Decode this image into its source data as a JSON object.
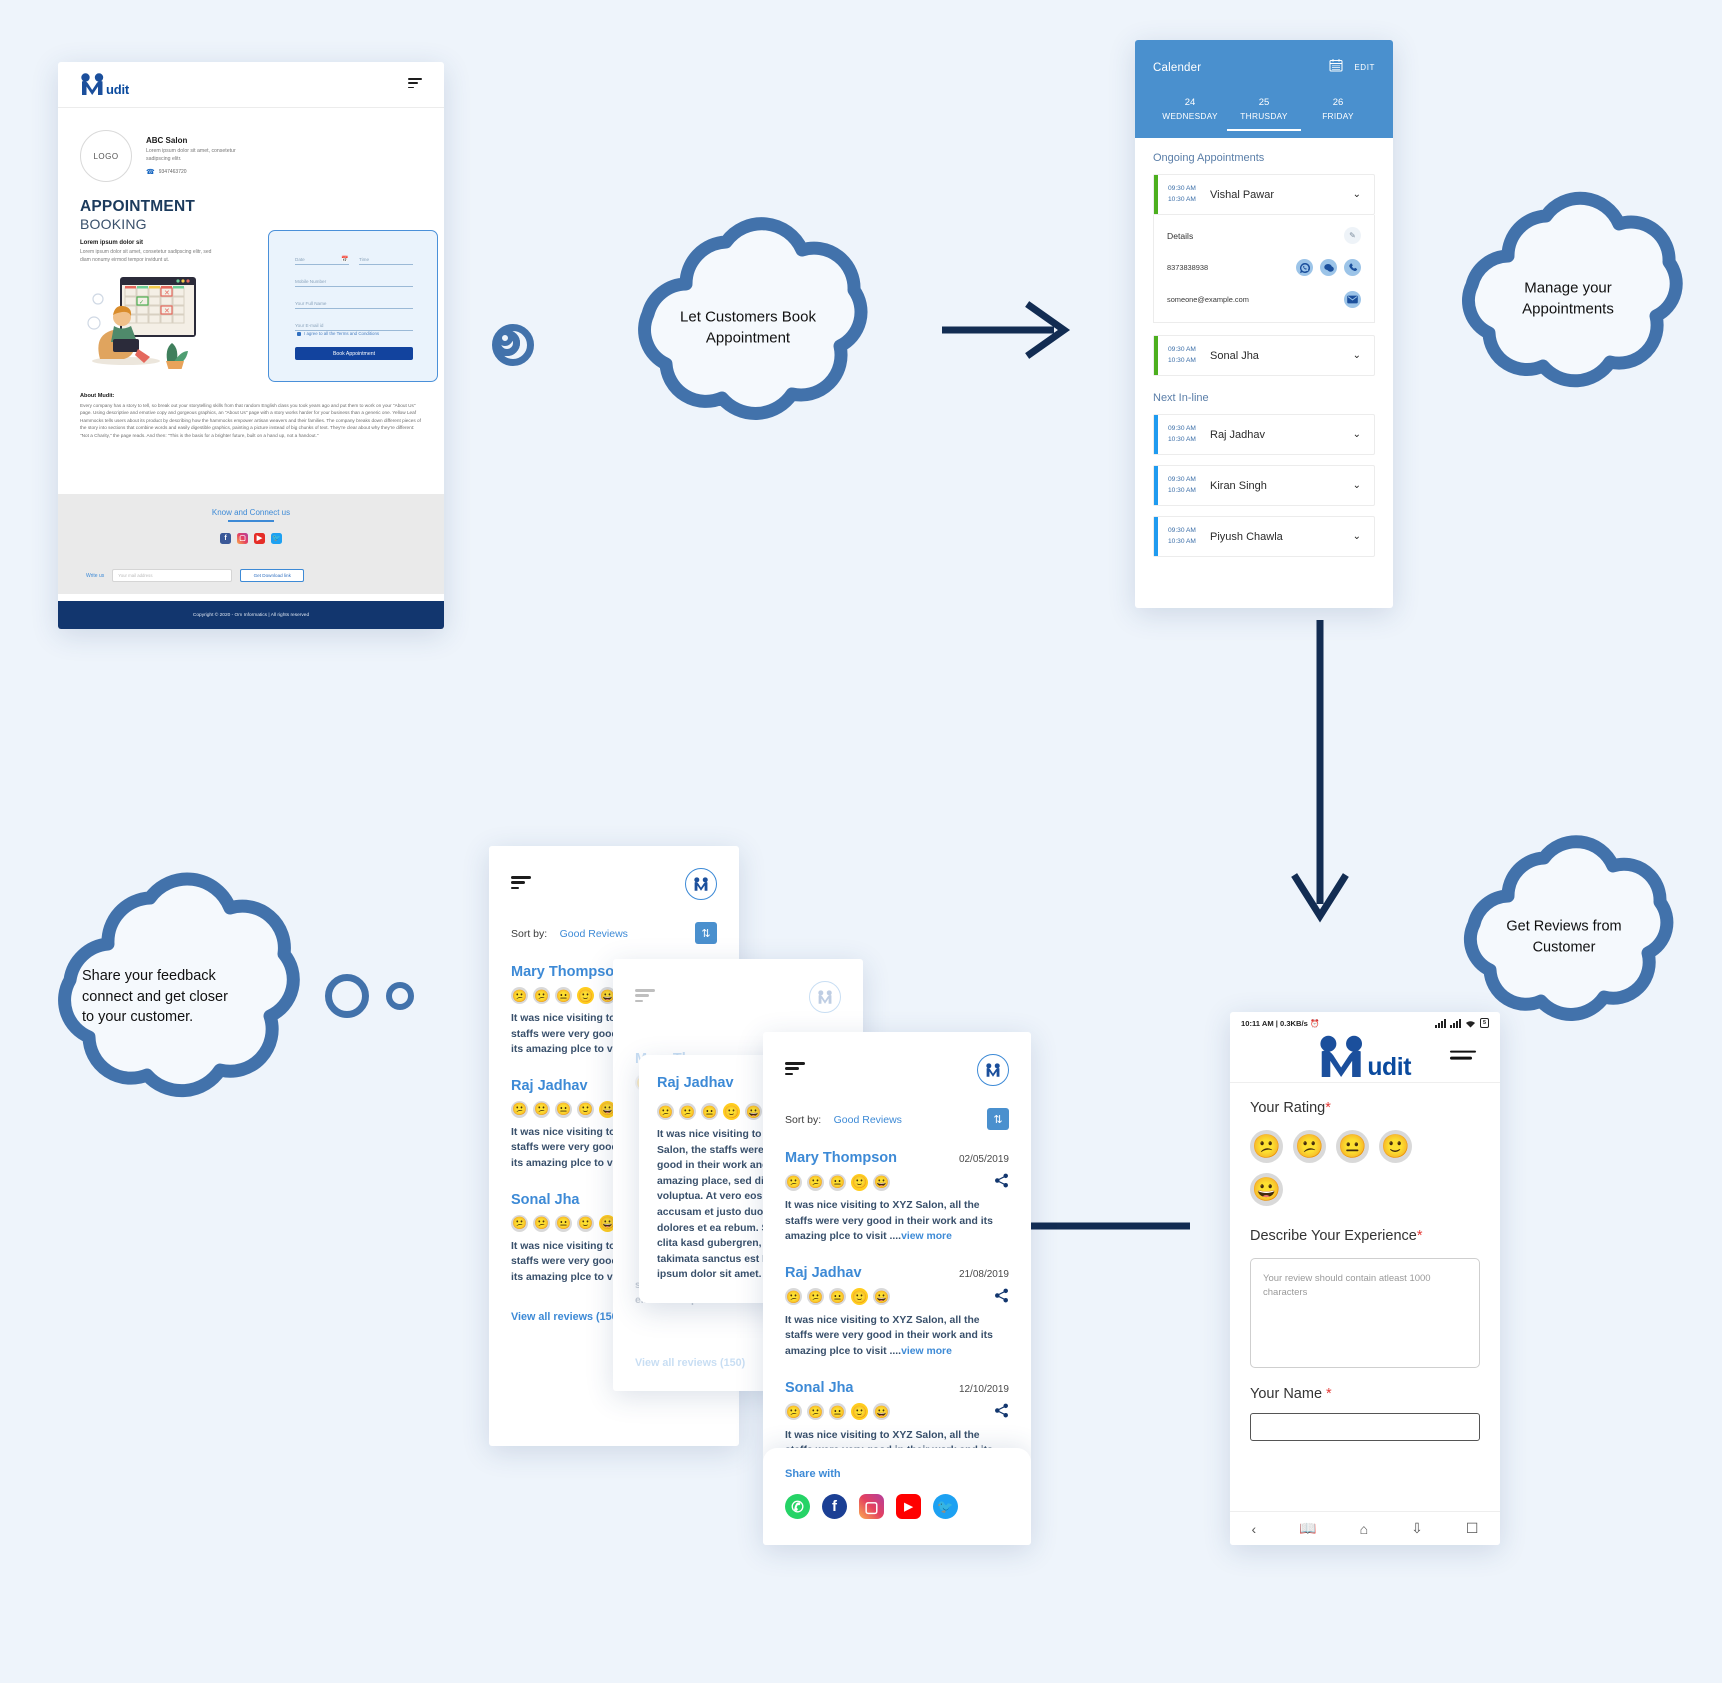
{
  "brand": {
    "name": "Mudit",
    "accent": "#3d8ad6",
    "dark_blue": "#12366e",
    "cloud_stroke": "#4272ab"
  },
  "desktop": {
    "logo_text": "udit",
    "menu_icon": "hamburger-icon",
    "salon": {
      "logo_placeholder": "LOGO",
      "name": "ABC Salon",
      "description": "Lorem ipsum dolor sit amet, consetetur sadipscing elitr.",
      "phone": "9347463720"
    },
    "heading_line1": "APPOINTMENT",
    "heading_line2": "BOOKING",
    "lead_heading": "Lorem ipsum dolor sit",
    "lead_body": "Lorem ipsum dolor sit amet, consetetur sadipscing elitr, sed diam nonumy eirmod tempor invidunt ut.",
    "form": {
      "date_placeholder": "Date",
      "date_icon": "calendar-icon",
      "time_placeholder": "Time",
      "mobile_placeholder": "Mobile Number",
      "fullname_placeholder": "Your Full Name",
      "email_placeholder": "Your E-mail id",
      "terms_label": "I agree to all the Terms and Conditions",
      "submit_label": "Book Appointment"
    },
    "about_heading": "About Mudit:",
    "about_body": "Every company has a story to tell, so break out your storytelling skills from that random English class you took years ago and put them to work on your \"About Us\" page. Using descriptive and emotive copy and gorgeous graphics, an \"About Us\" page with a story works harder for your business than a generic one. Yellow Leaf Hammocks tells users about its product by describing how the hammocks empower artisan weavers and their families. The company breaks down different pieces of the story into sections that combine words and easily digestible graphics, painting a picture instead of big chunks of text. They're clear about why they're different: \"Not a Charity,\" the page reads. And then: \"This is the basis for a brighter future, built on a hand up, not a handout.\"",
    "connect_heading": "Know and Connect us",
    "social": [
      "facebook-icon",
      "instagram-icon",
      "youtube-icon",
      "twitter-icon"
    ],
    "write_label": "Write us",
    "write_placeholder": "Your mail address",
    "download_label": "Get Download link",
    "footer": "Copyright © 2020 - Om  Informatics | All rights  reserved"
  },
  "calendar": {
    "title": "Calender",
    "calendar_icon": "calendar-icon",
    "edit_label": "EDIT",
    "days": [
      {
        "num": "24",
        "name": "WEDNESDAY",
        "active": false
      },
      {
        "num": "25",
        "name": "THRUSDAY",
        "active": true
      },
      {
        "num": "26",
        "name": "FRIDAY",
        "active": false
      }
    ],
    "ongoing_heading": "Ongoing Appointments",
    "ongoing": [
      {
        "start": "09:30 AM",
        "end": "10:30 AM",
        "name": "Vishal Pawar",
        "expanded": true
      },
      {
        "start": "09:30 AM",
        "end": "10:30 AM",
        "name": "Sonal Jha",
        "expanded": false
      }
    ],
    "details": {
      "label": "Details",
      "edit_icon": "pencil-icon",
      "phone": "8373838938",
      "email": "someone@example.com",
      "phone_actions": [
        "whatsapp-icon",
        "message-icon",
        "call-icon"
      ],
      "email_action": "mail-icon"
    },
    "next_heading": "Next In-line",
    "next": [
      {
        "start": "09:30 AM",
        "end": "10:30 AM",
        "name": "Raj Jadhav"
      },
      {
        "start": "09:30 AM",
        "end": "10:30 AM",
        "name": "Kiran Singh"
      },
      {
        "start": "09:30 AM",
        "end": "10:30 AM",
        "name": "Piyush Chawla"
      }
    ]
  },
  "clouds": [
    {
      "id": "book",
      "text": "Let Customers Book\nAppointment"
    },
    {
      "id": "manage",
      "text": "Manage your\nAppointments"
    },
    {
      "id": "reviews",
      "text": "Get Reviews from\nCustomer"
    },
    {
      "id": "feedback",
      "text": "Share your feedback\nconnect and get closer\nto your customer."
    }
  ],
  "reviews_screen": {
    "menu_icon": "hamburger-icon",
    "logo_icon": "mudit-circle-logo-icon",
    "sort_label": "Sort by:",
    "sort_value": "Good Reviews",
    "sort_toggle_icon": "sort-arrows-icon",
    "share_icon": "share-icon",
    "view_more": "view more",
    "view_all": "View all reviews (150)",
    "items": [
      {
        "name": "Mary Thompson",
        "date": "02/05/2019",
        "rating": 4,
        "text": "It was nice visiting to XYZ Salon, all the staffs were very good in their work and its amazing plce to visit ...."
      },
      {
        "name": "Raj Jadhav",
        "date": "21/08/2019",
        "rating": 4,
        "text": "It was nice visiting to XYZ Salon, all the staffs were very good in their work and its amazing plce to visit ...."
      },
      {
        "name": "Sonal Jha",
        "date": "12/10/2019",
        "rating": 4,
        "text": "It was nice visiting to XYZ Salon, all the staffs were very good in their work and its amazing plce to visit ...."
      }
    ],
    "detail_popup": {
      "name": "Raj Jadhav",
      "rating": 4,
      "text": "It was nice visiting to XYZ Salon, the staffs were very good in their work and its amazing place, sed diam voluptua. At vero eos et accusam et justo duo dolores et ea rebum. Stet clita kasd gubergren, no sea takimata sanctus est Lorem ipsum dolor sit amet."
    },
    "faded_text_tail": "sadipscing elitr, sed diam nonumy eirmod tempor invidunt ....view more",
    "share_panel": {
      "heading": "Share with",
      "icons": [
        "whatsapp-icon",
        "facebook-icon",
        "instagram-icon",
        "youtube-icon",
        "twitter-icon"
      ]
    }
  },
  "feedback_screen": {
    "status_left": "10:11 AM | 0.3KB/s",
    "status_alarm_icon": "alarm-icon",
    "status_right_icons": [
      "signal-icon",
      "signal-2-icon",
      "wifi-icon",
      "battery-icon"
    ],
    "battery_text": "5",
    "logo_text": "udit",
    "menu_icon": "hamburger-icon",
    "rating_label": "Your Rating",
    "rating_required": "*",
    "rating_emojis": [
      "sad-face",
      "confused-face",
      "neutral-face",
      "smile-face",
      "grin-face"
    ],
    "experience_label": "Describe Your Experience",
    "experience_required": "*",
    "experience_placeholder": "Your review should contain atleast 1000 characters",
    "name_label": "Your Name ",
    "name_required": "*",
    "nav_icons": [
      "back-icon",
      "book-icon",
      "home-icon",
      "download-icon",
      "tabs-icon"
    ]
  }
}
